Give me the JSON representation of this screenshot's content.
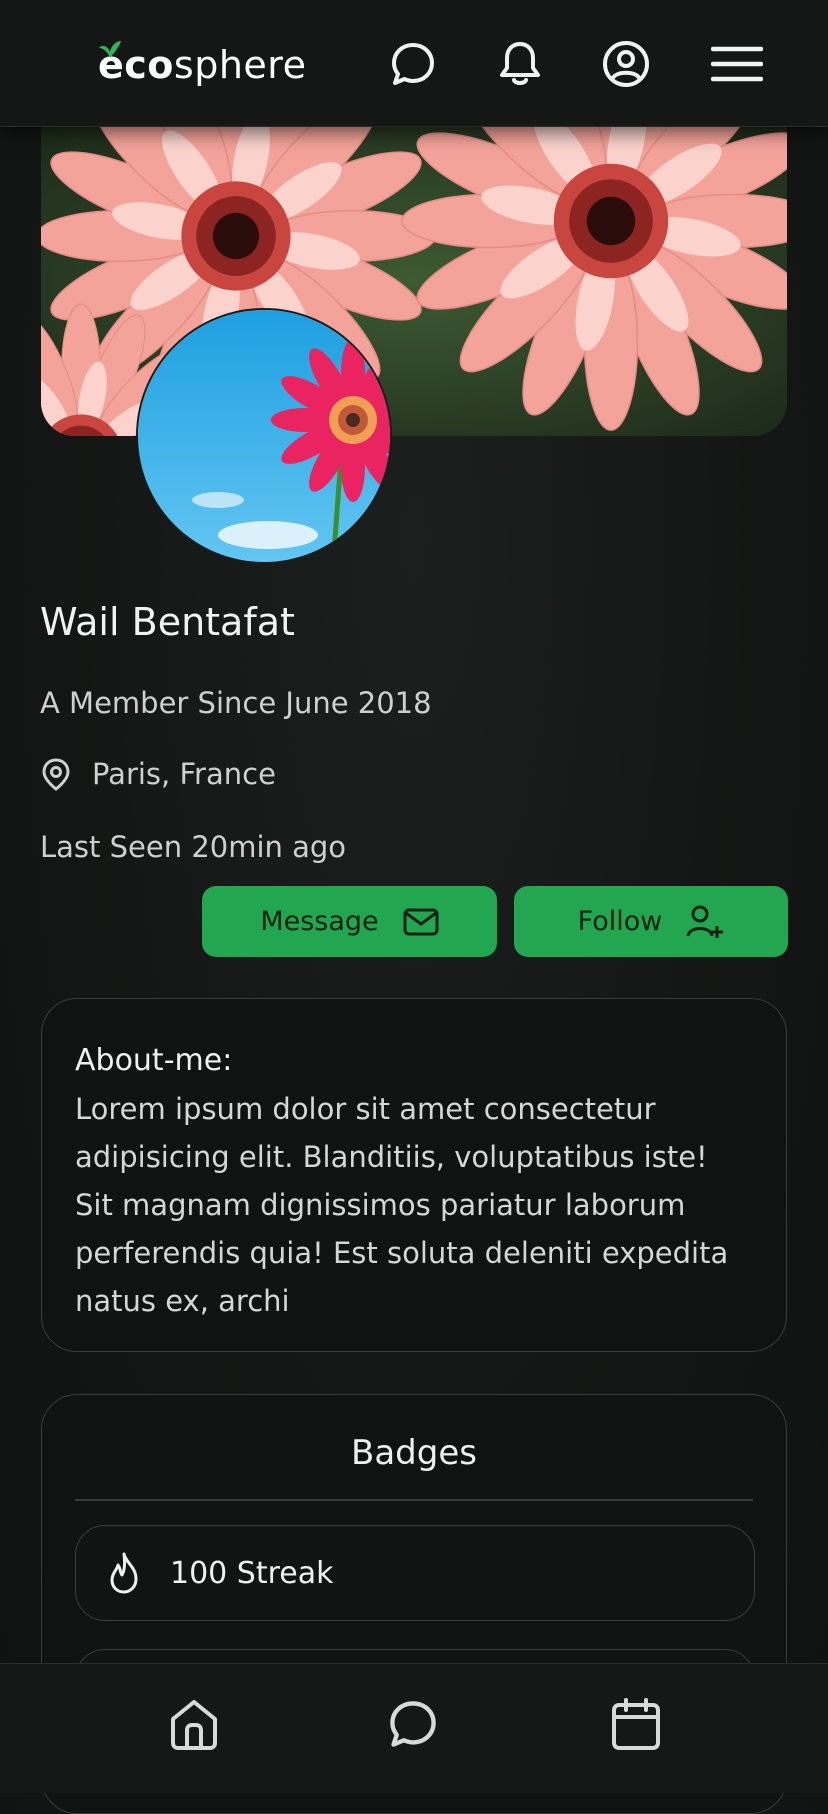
{
  "header": {
    "logo_bold": "eco",
    "logo_rest": "sphere",
    "icons": [
      "chat-icon",
      "bell-icon",
      "account-icon",
      "menu-icon"
    ]
  },
  "profile": {
    "name": "Wail Bentafat",
    "member_since": "A Member Since June 2018",
    "location": "Paris, France",
    "last_seen": "Last Seen 20min ago"
  },
  "actions": {
    "message_label": "Message",
    "follow_label": "Follow"
  },
  "about": {
    "heading": "About-me:",
    "text": "Lorem ipsum dolor sit amet consectetur adipisicing elit. Blanditiis, voluptatibus iste! Sit magnam dignissimos pariatur laborum perferendis quia! Est soluta deleniti expedita natus ex, archi"
  },
  "badges": {
    "heading": "Badges",
    "items": [
      {
        "label": "100 Streak",
        "icon": "flame-icon"
      }
    ]
  },
  "bottom_nav": [
    "home-icon",
    "chat-icon",
    "calendar-icon"
  ],
  "colors": {
    "accent": "#22a650",
    "background": "#131614",
    "card_border": "#3a3d3c"
  }
}
